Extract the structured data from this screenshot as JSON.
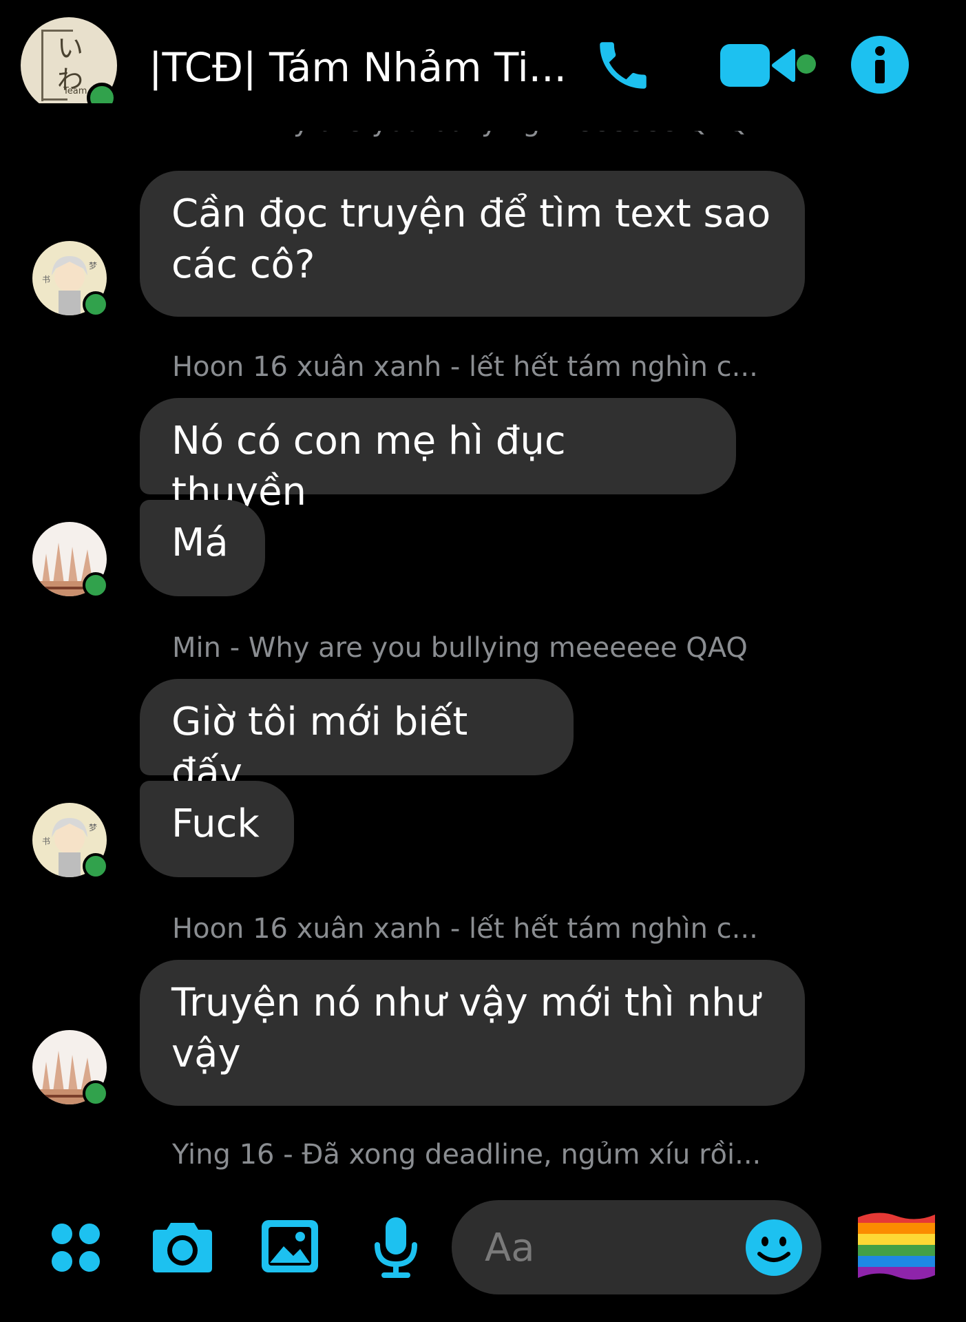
{
  "header": {
    "title": "|TCĐ| Tám Nhảm Ti...",
    "group_avatar_text": "いわ",
    "group_avatar_sub": "Team",
    "call_icon": "phone-icon",
    "video_icon": "video-camera-icon",
    "info_icon": "info-icon"
  },
  "colors": {
    "accent": "#1dc1f0",
    "bubble": "#303030",
    "sender_text": "#8a8d91",
    "online": "#31a24c",
    "background": "#000000"
  },
  "top_partial_sender": "Min - Why are you bullying meeeeee QAQ",
  "messages": [
    {
      "sender": "",
      "text": "Cần đọc truyện để tìm text sao\ncác cô?"
    },
    {
      "sender": "Hoon 16 xuân xanh - lết hết tám nghìn c...",
      "text": "Nó có con mẹ hì đục thuyền"
    },
    {
      "sender": "",
      "text": "Má"
    },
    {
      "sender": "Min - Why are you bullying meeeeee QAQ",
      "text": "Giờ tôi mới biết đấy"
    },
    {
      "sender": "",
      "text": "Fuck"
    },
    {
      "sender": "Hoon 16 xuân xanh - lết hết tám nghìn c...",
      "text": "Truyện nó như vậy mới thì như\nvậy"
    }
  ],
  "typing_sender": "Ying 16 - Đã xong deadline, ngủm xíu rồi...",
  "composer": {
    "placeholder": "Aa",
    "icons": [
      "apps-icon",
      "camera-icon",
      "image-icon",
      "microphone-icon",
      "emoji-icon",
      "rainbow-flag-icon"
    ]
  }
}
